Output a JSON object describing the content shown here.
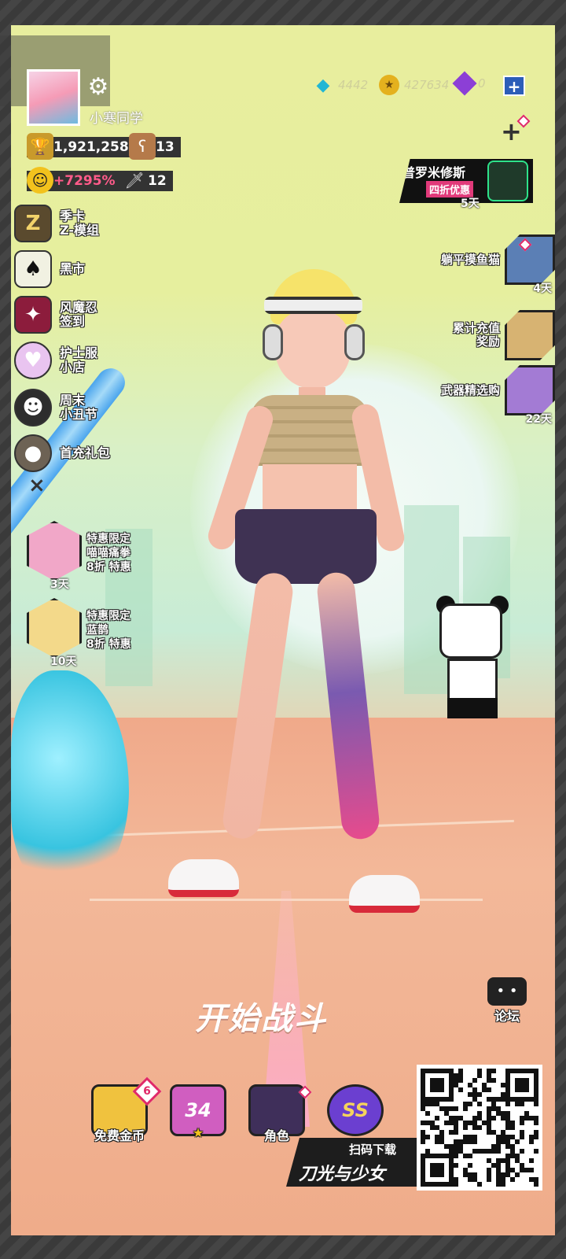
{
  "player": {
    "name": "小寒同学",
    "trophies": "1,921,258",
    "bear_count": "13",
    "bonus": "+7295%",
    "sword_count": "12"
  },
  "currency": {
    "gems": "4442",
    "gold": "427634",
    "tickets": "0",
    "add_label": "+"
  },
  "left_menu": [
    {
      "label_line1": "季卡",
      "label_line2": "Z-模组",
      "icon": "z-card-icon",
      "color": "#5a4a2e"
    },
    {
      "label_line1": "黑市",
      "label_line2": "",
      "icon": "spade-icon",
      "color": "#f1f1e2"
    },
    {
      "label_line1": "风魔忍",
      "label_line2": "签到",
      "icon": "ninja-star-icon",
      "color": "#8c1c3c"
    },
    {
      "label_line1": "护士服",
      "label_line2": "小店",
      "icon": "nurse-icon",
      "color": "#e9c4f0"
    },
    {
      "label_line1": "周末",
      "label_line2": "小丑节",
      "icon": "clown-icon",
      "color": "#2d2d2d"
    },
    {
      "label_line1": "首充礼包",
      "label_line2": "",
      "icon": "piggy-icon",
      "color": "#6d6254"
    }
  ],
  "close_label": "×",
  "offers": [
    {
      "line1": "特惠限定",
      "line2": "喵喵痛拳",
      "line3": "8折 特惠",
      "days": "3天",
      "color": "#f1a7c8"
    },
    {
      "line1": "特惠限定",
      "line2": "蓝鹊",
      "line3": "8折 特惠",
      "days": "10天",
      "color": "#f3d98a"
    }
  ],
  "right_events": {
    "promo_title": "普罗米修斯",
    "promo_sub": "四折优惠",
    "promo_days": "5天",
    "events": [
      {
        "label_line1": "躺平摸鱼猫",
        "label_line2": "",
        "days": "4天",
        "color": "#5b7fb5"
      },
      {
        "label_line1": "累计充值",
        "label_line2": "奖励",
        "days": "",
        "color": "#d7b372"
      },
      {
        "label_line1": "武器精选购",
        "label_line2": "",
        "days": "22天",
        "color": "#a37bd4"
      }
    ]
  },
  "main": {
    "start_battle": "开始战斗",
    "forum_label": "论坛",
    "forum_icon_text": "• •"
  },
  "bottom_bar": [
    {
      "label": "免费金币",
      "badge": "6",
      "icon_text": "",
      "color": "#f0c23e"
    },
    {
      "label": "",
      "badge": "",
      "icon_text": "34",
      "color": "#d05ec0"
    },
    {
      "label": "角色",
      "badge": "",
      "icon_text": "",
      "color": "#3f2f5a"
    },
    {
      "label": "",
      "badge": "",
      "icon_text": "SS",
      "color": "#6b3fd0"
    }
  ],
  "download": {
    "scan_label": "扫码下载",
    "game_name": "刀光与少女"
  }
}
